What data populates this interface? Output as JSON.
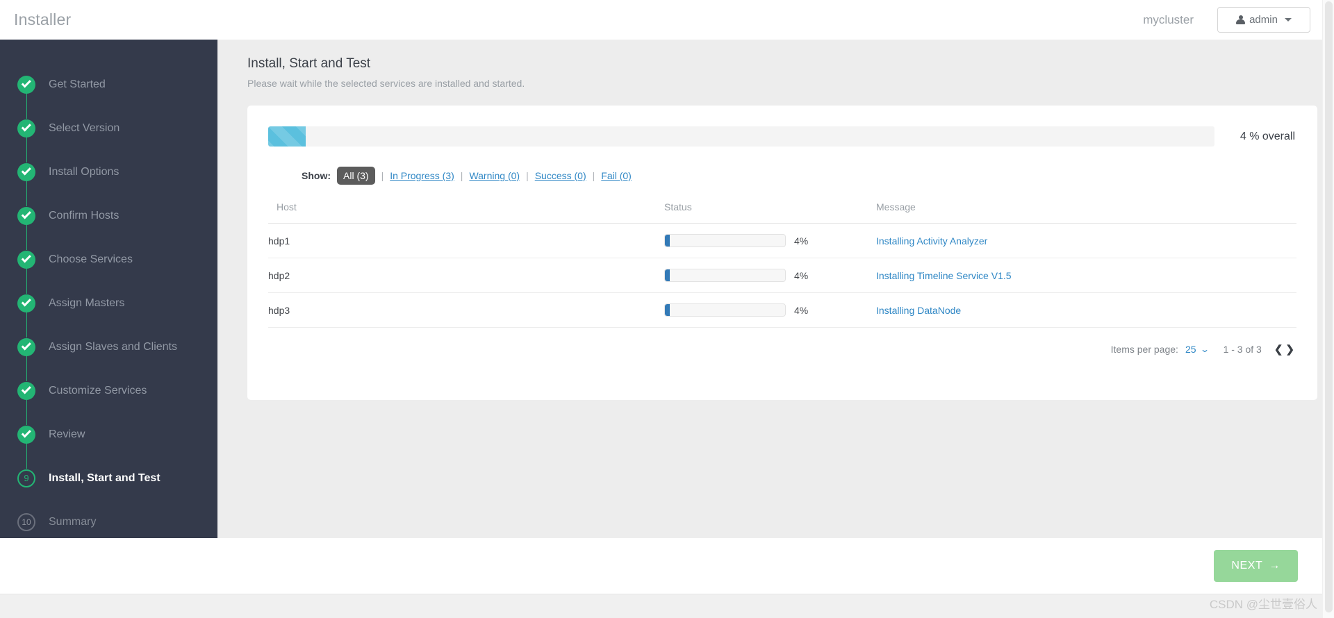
{
  "header": {
    "brand": "Installer",
    "cluster_name": "mycluster",
    "user_label": "admin",
    "user_icon": "person-icon",
    "caret_icon": "caret-down-icon"
  },
  "sidebar": {
    "steps": [
      {
        "label": "Get Started",
        "state": "done",
        "marker": "check"
      },
      {
        "label": "Select Version",
        "state": "done",
        "marker": "check"
      },
      {
        "label": "Install Options",
        "state": "done",
        "marker": "check"
      },
      {
        "label": "Confirm Hosts",
        "state": "done",
        "marker": "check"
      },
      {
        "label": "Choose Services",
        "state": "done",
        "marker": "check"
      },
      {
        "label": "Assign Masters",
        "state": "done",
        "marker": "check"
      },
      {
        "label": "Assign Slaves and Clients",
        "state": "done",
        "marker": "check"
      },
      {
        "label": "Customize Services",
        "state": "done",
        "marker": "check"
      },
      {
        "label": "Review",
        "state": "done",
        "marker": "check"
      },
      {
        "label": "Install, Start and Test",
        "state": "active",
        "marker": "9"
      },
      {
        "label": "Summary",
        "state": "todo",
        "marker": "10"
      }
    ]
  },
  "main": {
    "title": "Install, Start and Test",
    "subtitle": "Please wait while the selected services are installed and started.",
    "overall": {
      "percent": 4,
      "percent_label": "4 % overall",
      "fill_color": "#5bc0de"
    },
    "filters": {
      "label": "Show:",
      "separator": "|",
      "items": [
        {
          "label": "All (3)",
          "active": true
        },
        {
          "label": "In Progress (3)",
          "active": false
        },
        {
          "label": "Warning (0)",
          "active": false
        },
        {
          "label": "Success (0)",
          "active": false
        },
        {
          "label": "Fail (0)",
          "active": false
        }
      ]
    },
    "table": {
      "columns": [
        "Host",
        "Status",
        "Message"
      ],
      "rows": [
        {
          "host": "hdp1",
          "percent": 4,
          "percent_label": "4%",
          "message": "Installing Activity Analyzer"
        },
        {
          "host": "hdp2",
          "percent": 4,
          "percent_label": "4%",
          "message": "Installing Timeline Service V1.5"
        },
        {
          "host": "hdp3",
          "percent": 4,
          "percent_label": "4%",
          "message": "Installing DataNode"
        }
      ]
    },
    "pagination": {
      "items_per_page_label": "Items per page:",
      "items_per_page_value": "25",
      "dropdown_icon": "chevron-down-icon",
      "range_label": "1 - 3 of 3",
      "prev_icon": "chevron-left-icon",
      "next_icon": "chevron-right-icon"
    }
  },
  "footer": {
    "next_label": "NEXT",
    "next_arrow": "→"
  },
  "watermark": "CSDN @尘世壹俗人",
  "colors": {
    "sidebar_bg": "#343a4b",
    "step_done": "#23b574",
    "link": "#2f87c5",
    "row_progress": "#337ab7",
    "next_button": "#96d79a"
  }
}
